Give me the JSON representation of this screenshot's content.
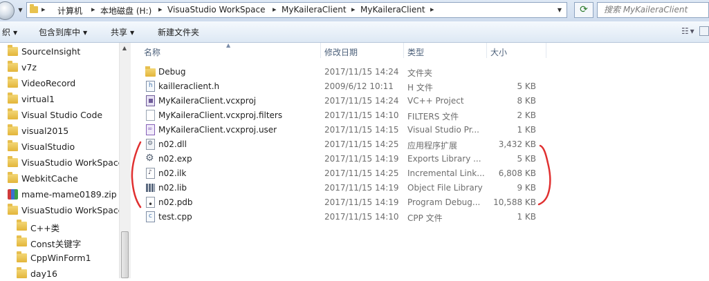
{
  "address": {
    "crumbs": [
      "计算机",
      "本地磁盘 (H:)",
      "VisuaStudio WorkSpace",
      "MyKaileraClient",
      "MyKaileraClient"
    ],
    "search_placeholder": "搜索 MyKaileraClient"
  },
  "toolbar": {
    "organize": "织",
    "include_in_library": "包含到库中",
    "share": "共享",
    "new_folder": "新建文件夹"
  },
  "nav": {
    "items": [
      {
        "label": "SourceInsight",
        "icon": "folder-icon",
        "indent": 0
      },
      {
        "label": "v7z",
        "icon": "folder-icon",
        "indent": 0
      },
      {
        "label": "VideoRecord",
        "icon": "folder-icon",
        "indent": 0
      },
      {
        "label": "virtual1",
        "icon": "folder-icon",
        "indent": 0
      },
      {
        "label": "Visual Studio Code",
        "icon": "folder-icon",
        "indent": 0
      },
      {
        "label": "visual2015",
        "icon": "folder-icon",
        "indent": 0
      },
      {
        "label": "VisualStudio",
        "icon": "folder-icon",
        "indent": 0
      },
      {
        "label": "VisuaStudio WorkSpace",
        "icon": "folder-icon",
        "indent": 0
      },
      {
        "label": "WebkitCache",
        "icon": "folder-icon",
        "indent": 0
      },
      {
        "label": "mame-mame0189.zip",
        "icon": "zip-icon",
        "indent": 0
      },
      {
        "label": "VisuaStudio WorkSpace",
        "icon": "folder-icon",
        "indent": 0
      },
      {
        "label": "C++类",
        "icon": "folder-icon",
        "indent": 1
      },
      {
        "label": "Const关键字",
        "icon": "folder-icon",
        "indent": 1
      },
      {
        "label": "CppWinForm1",
        "icon": "folder-icon",
        "indent": 1
      },
      {
        "label": "day16",
        "icon": "folder-icon",
        "indent": 1
      }
    ]
  },
  "columns": {
    "name": "名称",
    "modified": "修改日期",
    "type": "类型",
    "size": "大小"
  },
  "files": [
    {
      "name": "Debug",
      "modified": "2017/11/15 14:24",
      "type": "文件夹",
      "size": "",
      "icon": "folder-icon"
    },
    {
      "name": "kailleraclient.h",
      "modified": "2009/6/12 10:11",
      "type": "H 文件",
      "size": "5 KB",
      "icon": "header-file-icon"
    },
    {
      "name": "MyKaileraClient.vcxproj",
      "modified": "2017/11/15 14:24",
      "type": "VC++ Project",
      "size": "8 KB",
      "icon": "vcxproj-icon"
    },
    {
      "name": "MyKaileraClient.vcxproj.filters",
      "modified": "2017/11/15 14:10",
      "type": "FILTERS 文件",
      "size": "2 KB",
      "icon": "generic-file-icon"
    },
    {
      "name": "MyKaileraClient.vcxproj.user",
      "modified": "2017/11/15 14:15",
      "type": "Visual Studio Pr...",
      "size": "1 KB",
      "icon": "vs-user-file-icon"
    },
    {
      "name": "n02.dll",
      "modified": "2017/11/15 14:25",
      "type": "应用程序扩展",
      "size": "3,432 KB",
      "icon": "dll-icon"
    },
    {
      "name": "n02.exp",
      "modified": "2017/11/15 14:19",
      "type": "Exports Library ...",
      "size": "5 KB",
      "icon": "exp-icon"
    },
    {
      "name": "n02.ilk",
      "modified": "2017/11/15 14:25",
      "type": "Incremental Link...",
      "size": "6,808 KB",
      "icon": "ilk-icon"
    },
    {
      "name": "n02.lib",
      "modified": "2017/11/15 14:19",
      "type": "Object File Library",
      "size": "9 KB",
      "icon": "lib-icon"
    },
    {
      "name": "n02.pdb",
      "modified": "2017/11/15 14:19",
      "type": "Program Debug...",
      "size": "10,588 KB",
      "icon": "pdb-icon"
    },
    {
      "name": "test.cpp",
      "modified": "2017/11/15 14:10",
      "type": "CPP 文件",
      "size": "1 KB",
      "icon": "cpp-file-icon"
    }
  ],
  "colors": {
    "annotation": "#e03030",
    "folder": "#e3b53a",
    "column_header": "#4c607a"
  }
}
